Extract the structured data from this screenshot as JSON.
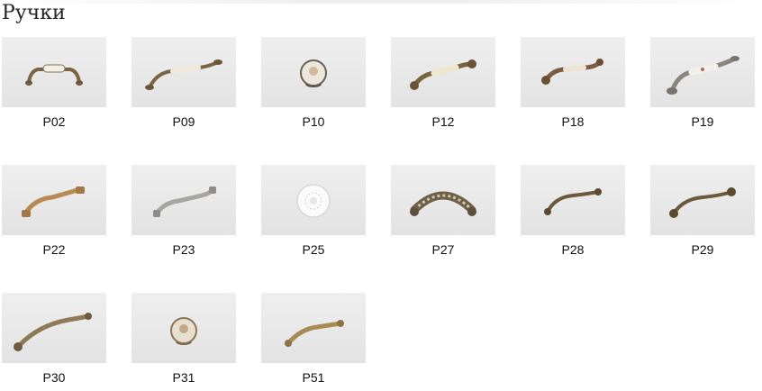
{
  "page": {
    "title": "Ручки"
  },
  "products": [
    {
      "code": "P02",
      "icon": "handle-bronze-ceramic-icon"
    },
    {
      "code": "P09",
      "icon": "handle-bronze-ceramic-icon"
    },
    {
      "code": "P10",
      "icon": "knob-ceramic-icon"
    },
    {
      "code": "P12",
      "icon": "handle-bronze-ceramic-icon"
    },
    {
      "code": "P18",
      "icon": "handle-bronze-ceramic-icon"
    },
    {
      "code": "P19",
      "icon": "handle-silver-ceramic-icon"
    },
    {
      "code": "P22",
      "icon": "handle-copper-icon"
    },
    {
      "code": "P23",
      "icon": "handle-silver-icon"
    },
    {
      "code": "P25",
      "icon": "knob-white-icon"
    },
    {
      "code": "P27",
      "icon": "handle-lattice-bronze-icon"
    },
    {
      "code": "P28",
      "icon": "handle-bronze-icon"
    },
    {
      "code": "P29",
      "icon": "handle-bronze-icon"
    },
    {
      "code": "P30",
      "icon": "handle-bronze-icon"
    },
    {
      "code": "P31",
      "icon": "knob-ceramic-bronze-icon"
    },
    {
      "code": "P51",
      "icon": "handle-brass-icon"
    }
  ]
}
